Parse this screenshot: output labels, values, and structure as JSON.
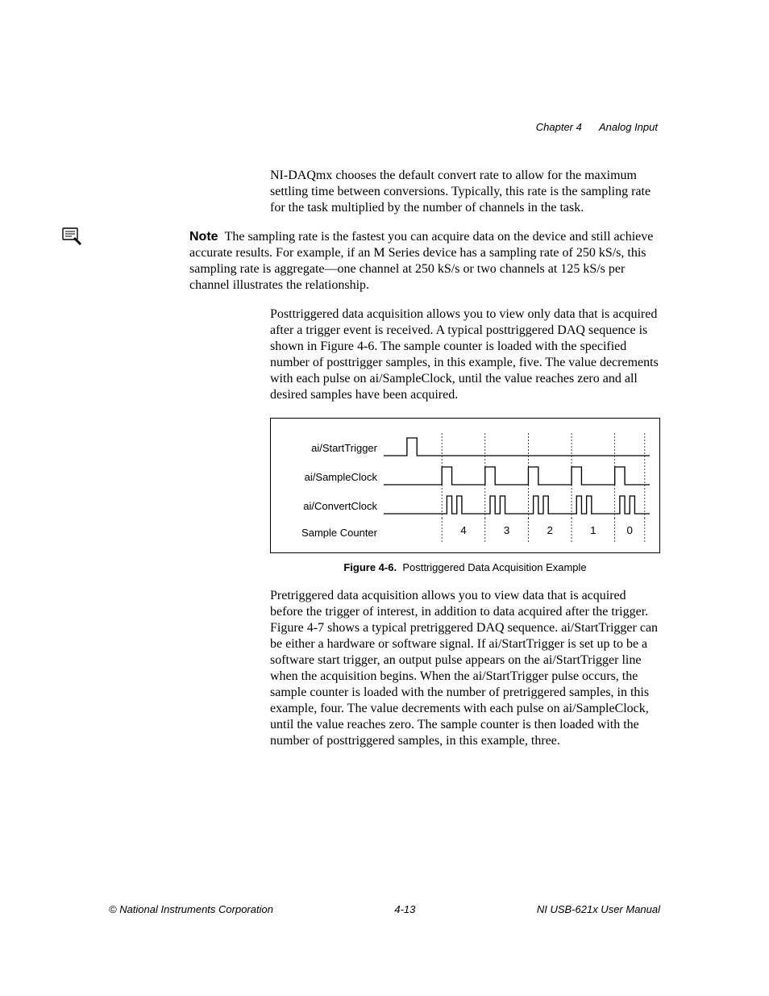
{
  "header": {
    "chapter": "Chapter 4",
    "title": "Analog Input"
  },
  "paragraphs": {
    "p1": "NI-DAQmx chooses the default convert rate to allow for the maximum settling time between conversions. Typically, this rate is the sampling rate for the task multiplied by the number of channels in the task.",
    "note_label": "Note",
    "note_body": "The sampling rate is the fastest you can acquire data on the device and still achieve accurate results. For example, if an M Series device has a sampling rate of 250 kS/s, this sampling rate is aggregate—one channel at 250 kS/s or two channels at 125 kS/s per channel illustrates the relationship.",
    "p2": "Posttriggered data acquisition allows you to view only data that is acquired after a trigger event is received. A typical posttriggered DAQ sequence is shown in Figure 4-6. The sample counter is loaded with the specified number of posttrigger samples, in this example, five. The value decrements with each pulse on ai/SampleClock, until the value reaches zero and all desired samples have been acquired.",
    "p3": "Pretriggered data acquisition allows you to view data that is acquired before the trigger of interest, in addition to data acquired after the trigger. Figure 4-7 shows a typical pretriggered DAQ sequence. ai/StartTrigger can be either a hardware or software signal. If ai/StartTrigger is set up to be a software start trigger, an output pulse appears on the ai/StartTrigger line when the acquisition begins. When the ai/StartTrigger pulse occurs, the sample counter is loaded with the number of pretriggered samples, in this example, four. The value decrements with each pulse on ai/SampleClock, until the value reaches zero. The sample counter is then loaded with the number of posttriggered samples, in this example, three."
  },
  "figure": {
    "signals": {
      "start_trigger": "ai/StartTrigger",
      "sample_clock": "ai/SampleClock",
      "convert_clock": "ai/ConvertClock",
      "sample_counter": "Sample Counter"
    },
    "counter_values": [
      "4",
      "3",
      "2",
      "1",
      "0"
    ],
    "caption_num": "Figure 4-6.",
    "caption_text": "Posttriggered Data Acquisition Example"
  },
  "footer": {
    "left": "© National Instruments Corporation",
    "center": "4-13",
    "right": "NI USB-621x User Manual"
  }
}
